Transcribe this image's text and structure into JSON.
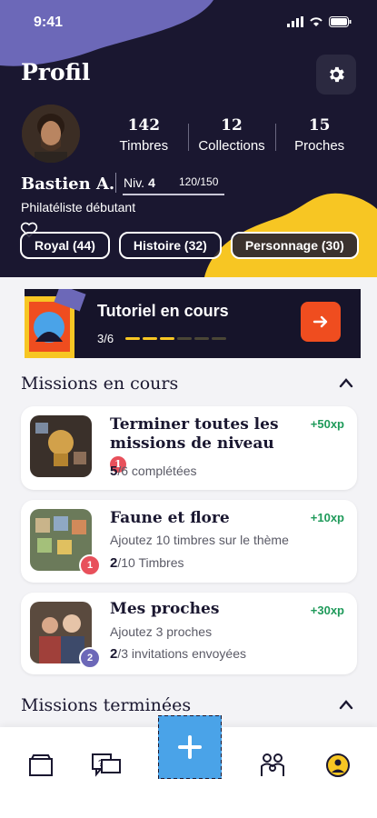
{
  "status": {
    "time": "9:41"
  },
  "header": {
    "title": "Profil"
  },
  "profile": {
    "name": "Bastien A.",
    "level_label": "Niv.",
    "level_value": "4",
    "xp": "120/150",
    "subtitle": "Philatéliste débutant",
    "stats": [
      {
        "value": "142",
        "label": "Timbres"
      },
      {
        "value": "12",
        "label": "Collections"
      },
      {
        "value": "15",
        "label": "Proches"
      }
    ],
    "chips": [
      "Royal (44)",
      "Histoire (32)",
      "Personnage (30)"
    ]
  },
  "tutorial": {
    "title": "Tutoriel en cours",
    "progress_text": "3/6",
    "progress": 0.5
  },
  "missions_active": {
    "title": "Missions en cours",
    "items": [
      {
        "title": "Terminer toutes les missions de niveau",
        "xp": "+50xp",
        "badge": "1",
        "desc": "",
        "done": "5",
        "total": "/6",
        "suffix": "complétées"
      },
      {
        "title": "Faune et flore",
        "xp": "+10xp",
        "badge": "1",
        "desc": "Ajoutez 10 timbres sur le thème",
        "done": "2",
        "total": "/10",
        "suffix": "Timbres"
      },
      {
        "title": "Mes proches",
        "xp": "+30xp",
        "badge": "2",
        "desc": "Ajoutez 3 proches",
        "done": "2",
        "total": "/3",
        "suffix": "invitations envoyées"
      }
    ]
  },
  "missions_done": {
    "title": "Missions terminées"
  },
  "colors": {
    "navy": "#1a1730",
    "purple": "#6c68b8",
    "yellow": "#f7c623",
    "orange": "#ef4d1f",
    "green": "#1f9a5a",
    "blue": "#4aa3e8"
  },
  "icons": [
    "settings-gear-icon",
    "heart-icon",
    "arrow-right-icon",
    "chevron-up-icon",
    "collection-box-icon",
    "quiz-chat-icon",
    "plus-icon",
    "family-icon",
    "profile-face-icon"
  ]
}
